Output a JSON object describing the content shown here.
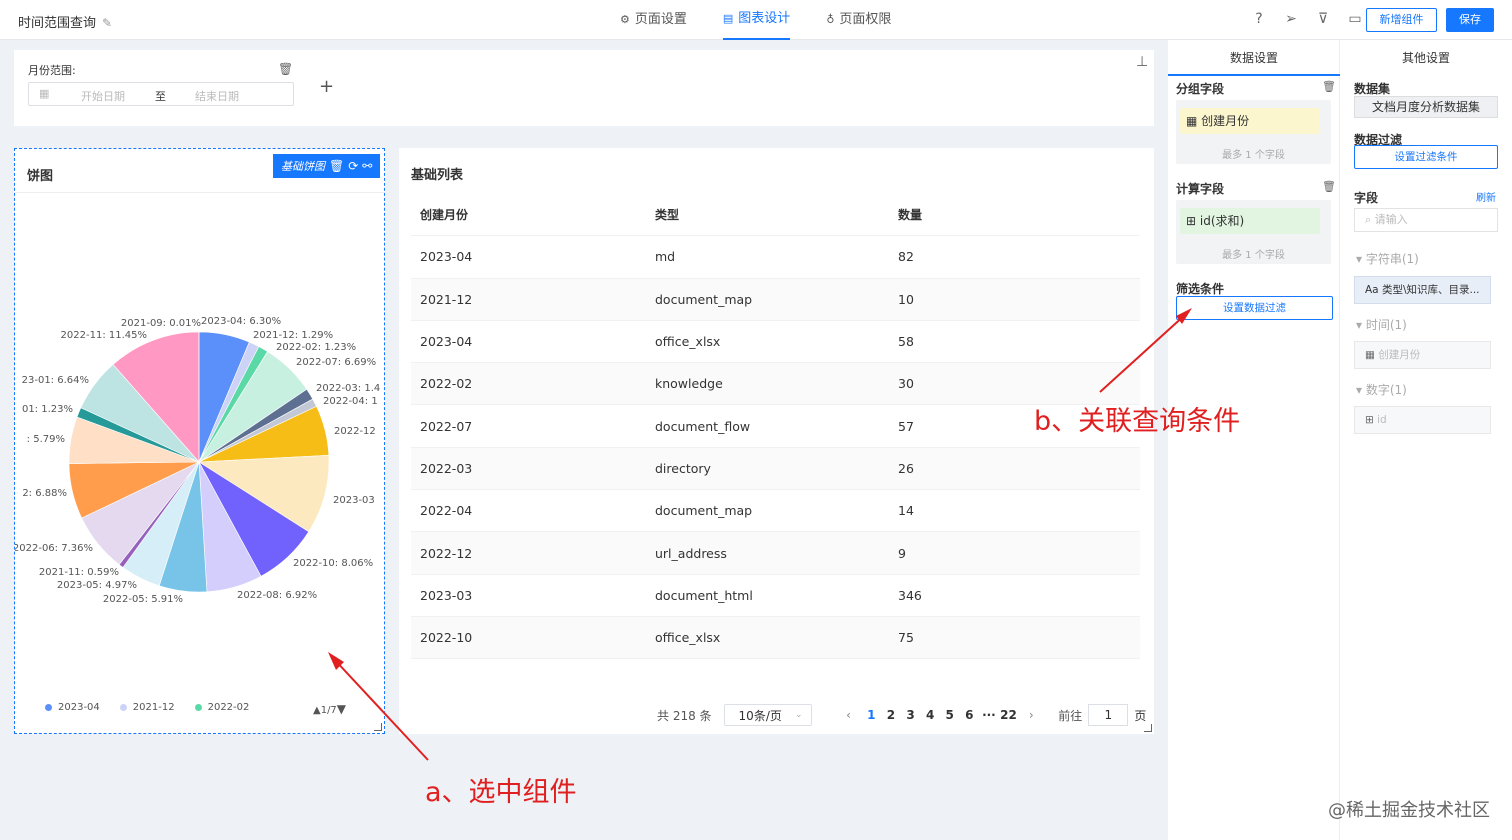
{
  "header": {
    "title": "时间范围查询",
    "tabs": [
      {
        "label": "页面设置",
        "active": false
      },
      {
        "label": "图表设计",
        "active": true
      },
      {
        "label": "页面权限",
        "active": false
      }
    ],
    "add_button": "新增组件",
    "save_button": "保存"
  },
  "filter": {
    "label": "月份范围:",
    "start_placeholder": "开始日期",
    "separator": "至",
    "end_placeholder": "结束日期"
  },
  "pie_card": {
    "title": "饼图",
    "toolbar_label": "基础饼图",
    "legend": [
      {
        "label": "2023-04",
        "color": "#5b8ff9"
      },
      {
        "label": "2021-12",
        "color": "#cdd3f7"
      },
      {
        "label": "2022-02",
        "color": "#5ad8a6"
      }
    ],
    "legend_page": "1/7"
  },
  "chart_data": {
    "type": "pie",
    "slices": [
      {
        "label": "2023-04: 6.30%",
        "value": 6.3,
        "color": "#5b8ff9"
      },
      {
        "label": "2021-12: 1.29%",
        "value": 1.29,
        "color": "#cdd3f7"
      },
      {
        "label": "2022-02: 1.23%",
        "value": 1.23,
        "color": "#5ad8a6"
      },
      {
        "label": "2022-07: 6.69%",
        "value": 6.69,
        "color": "#c8f0e0"
      },
      {
        "label": "2022-03: 1.4",
        "value": 1.4,
        "color": "#5d7092"
      },
      {
        "label": "2022-04: 1",
        "value": 1.0,
        "color": "#c2c8d5"
      },
      {
        "label": "2022-12",
        "value": 6.2,
        "color": "#f6bd16"
      },
      {
        "label": "2023-03",
        "value": 9.8,
        "color": "#fde9bf"
      },
      {
        "label": "2022-10: 8.06%",
        "value": 8.06,
        "color": "#7262fd"
      },
      {
        "label": "2022-08: 6.92%",
        "value": 6.92,
        "color": "#d3cefc"
      },
      {
        "label": "2022-05: 5.91%",
        "value": 5.91,
        "color": "#78c4e8"
      },
      {
        "label": "2023-05: 4.97%",
        "value": 4.97,
        "color": "#d5eef8"
      },
      {
        "label": "2021-11: 0.59%",
        "value": 0.59,
        "color": "#9661bc"
      },
      {
        "label": "2022-06: 7.36%",
        "value": 7.36,
        "color": "#e4d9ef"
      },
      {
        "label": "2: 6.88%",
        "value": 6.88,
        "color": "#ff9d4d"
      },
      {
        "label": ": 5.79%",
        "value": 5.79,
        "color": "#ffe0c7"
      },
      {
        "label": "01: 1.23%",
        "value": 1.23,
        "color": "#269a99"
      },
      {
        "label": "23-01: 6.64%",
        "value": 6.64,
        "color": "#bde3e3"
      },
      {
        "label": "2022-11: 11.45%",
        "value": 11.45,
        "color": "#ff99c3"
      },
      {
        "label": "2021-09: 0.01%",
        "value": 0.01,
        "color": "#ffd6e7"
      }
    ]
  },
  "list_card": {
    "title": "基础列表",
    "columns": [
      "创建月份",
      "类型",
      "数量"
    ],
    "rows": [
      [
        "2023-04",
        "md",
        "82"
      ],
      [
        "2021-12",
        "document_map",
        "10"
      ],
      [
        "2023-04",
        "office_xlsx",
        "58"
      ],
      [
        "2022-02",
        "knowledge",
        "30"
      ],
      [
        "2022-07",
        "document_flow",
        "57"
      ],
      [
        "2022-03",
        "directory",
        "26"
      ],
      [
        "2022-04",
        "document_map",
        "14"
      ],
      [
        "2022-12",
        "url_address",
        "9"
      ],
      [
        "2023-03",
        "document_html",
        "346"
      ],
      [
        "2022-10",
        "office_xlsx",
        "75"
      ]
    ],
    "pagination": {
      "total": "共 218 条",
      "page_size": "10条/页",
      "pages": [
        "1",
        "2",
        "3",
        "4",
        "5",
        "6",
        "···",
        "22"
      ],
      "current": "1",
      "goto_label": "前往",
      "goto_value": "1",
      "goto_suffix": "页"
    }
  },
  "data_settings": {
    "tab_label": "数据设置",
    "group_field_title": "分组字段",
    "group_field_chip": "创建月份",
    "group_field_hint": "最多 1 个字段",
    "calc_field_title": "计算字段",
    "calc_field_chip": "id(求和)",
    "calc_field_hint": "最多 1 个字段",
    "filter_title": "筛选条件",
    "filter_button": "设置数据过滤"
  },
  "other_settings": {
    "tab_label": "其他设置",
    "dataset_title": "数据集",
    "dataset_value": "文档月度分析数据集",
    "data_filter_title": "数据过滤",
    "data_filter_button": "设置过滤条件",
    "fields_title": "字段",
    "refresh": "刷新",
    "search_placeholder": "请输入",
    "groups": [
      {
        "label": "字符串(1)",
        "items": [
          "类型\\知识库、目录..."
        ]
      },
      {
        "label": "时间(1)",
        "items": [
          "创建月份"
        ]
      },
      {
        "label": "数字(1)",
        "items": [
          "id"
        ]
      }
    ]
  },
  "annotations": {
    "a": "a、选中组件",
    "b": "b、关联查询条件"
  },
  "watermark": "@稀土掘金技术社区"
}
